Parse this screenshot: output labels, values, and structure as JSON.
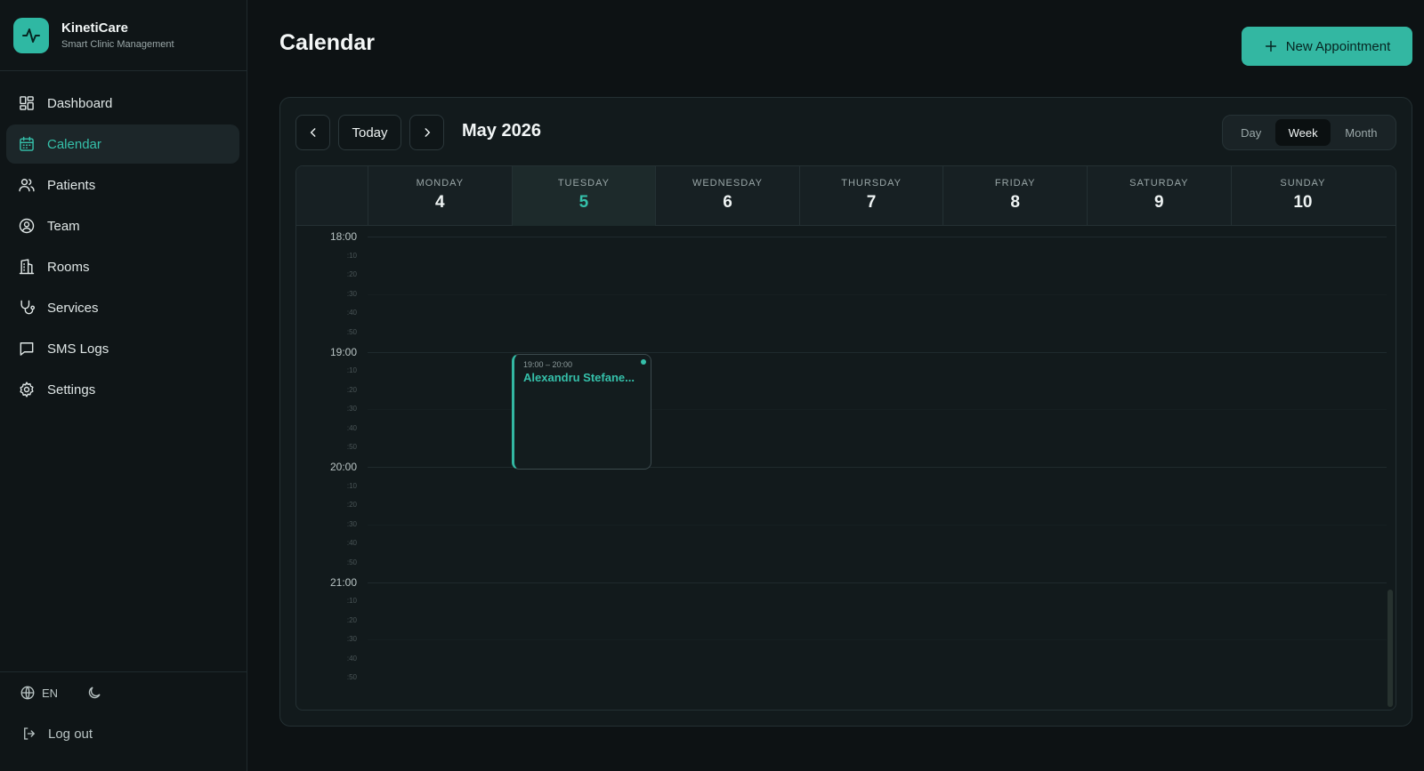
{
  "brand": {
    "name": "KinetiCare",
    "subtitle": "Smart Clinic Management"
  },
  "nav": [
    {
      "label": "Dashboard",
      "icon": "dashboard-icon"
    },
    {
      "label": "Calendar",
      "icon": "calendar-icon",
      "active": true
    },
    {
      "label": "Patients",
      "icon": "users-icon"
    },
    {
      "label": "Team",
      "icon": "user-circle-icon"
    },
    {
      "label": "Rooms",
      "icon": "building-icon"
    },
    {
      "label": "Services",
      "icon": "stethoscope-icon"
    },
    {
      "label": "SMS Logs",
      "icon": "message-icon"
    },
    {
      "label": "Settings",
      "icon": "gear-icon"
    }
  ],
  "footer": {
    "language": "EN",
    "logout_label": "Log out"
  },
  "page": {
    "title": "Calendar",
    "new_button": "New Appointment"
  },
  "toolbar": {
    "today_label": "Today",
    "month_label": "May 2026",
    "views": [
      "Day",
      "Week",
      "Month"
    ],
    "active_view": "Week"
  },
  "days": [
    {
      "name": "MONDAY",
      "num": "4"
    },
    {
      "name": "TUESDAY",
      "num": "5",
      "today": true
    },
    {
      "name": "WEDNESDAY",
      "num": "6"
    },
    {
      "name": "THURSDAY",
      "num": "7"
    },
    {
      "name": "FRIDAY",
      "num": "8"
    },
    {
      "name": "SATURDAY",
      "num": "9"
    },
    {
      "name": "SUNDAY",
      "num": "10"
    }
  ],
  "hours": [
    "18:00",
    "19:00",
    "20:00",
    "21:00"
  ],
  "minor_ticks": [
    ":10",
    ":20",
    ":30",
    ":40",
    ":50"
  ],
  "appointment": {
    "time": "19:00 – 20:00",
    "name": "Alexandru Stefane..."
  },
  "colors": {
    "accent": "#33b7a2",
    "background": "#0d1214",
    "panel": "#121a1c"
  }
}
